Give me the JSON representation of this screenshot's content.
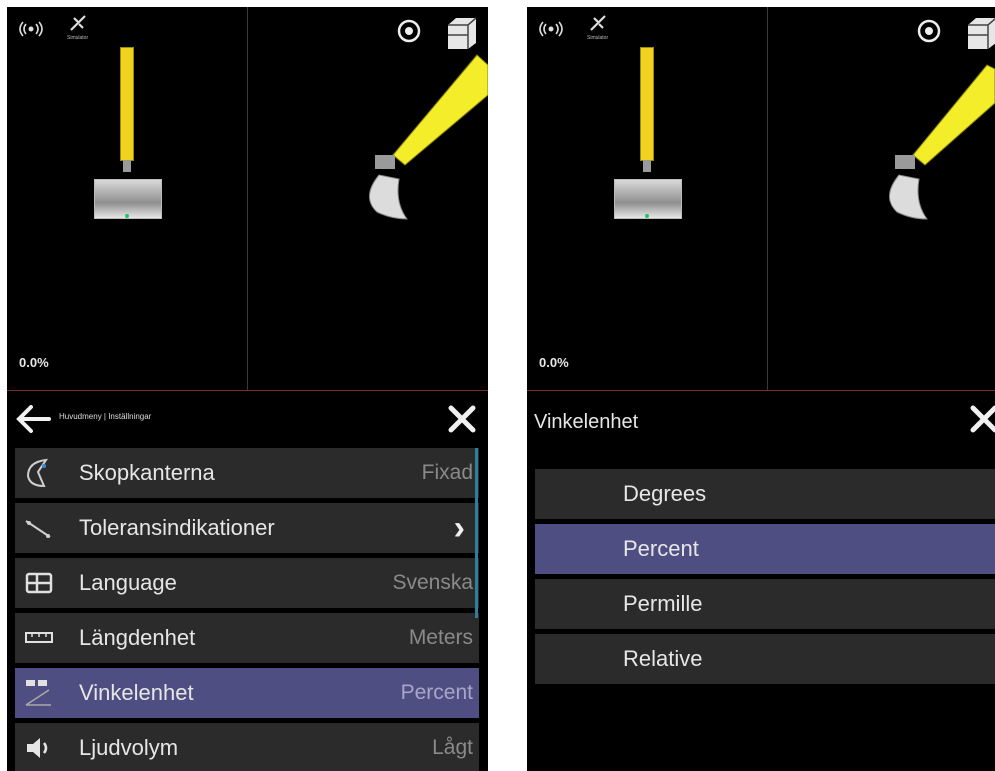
{
  "left": {
    "status": {
      "signal_icon": "signal-icon",
      "satellite_icon": "satellite-icon",
      "sim_label": "Simulator"
    },
    "grade_value": "0.0%",
    "breadcrumb": "Huvudmeny | Inställningar",
    "menu": [
      {
        "label": "Skopkanterna",
        "value": "Fixad",
        "icon": "bucket-edge-icon"
      },
      {
        "label": "Toleransindikationer",
        "value": "›",
        "icon": "tolerance-icon"
      },
      {
        "label": "Language",
        "value": "Svenska",
        "icon": "language-icon"
      },
      {
        "label": "Längdenhet",
        "value": "Meters",
        "icon": "length-unit-icon"
      },
      {
        "label": "Vinkelenhet",
        "value": "Percent",
        "icon": "angle-unit-icon",
        "selected": true
      },
      {
        "label": "Ljudvolym",
        "value": "Lågt",
        "icon": "volume-icon"
      }
    ]
  },
  "right": {
    "status": {
      "sim_label": "Simulator"
    },
    "grade_value": "0.0%",
    "title": "Vinkelenhet",
    "options": [
      {
        "label": "Degrees"
      },
      {
        "label": "Percent",
        "selected": true
      },
      {
        "label": "Permille"
      },
      {
        "label": "Relative"
      }
    ]
  },
  "colors": {
    "selected": "#4e4e82",
    "item_bg": "#2b2b2b",
    "stick": "#f0d21f"
  }
}
